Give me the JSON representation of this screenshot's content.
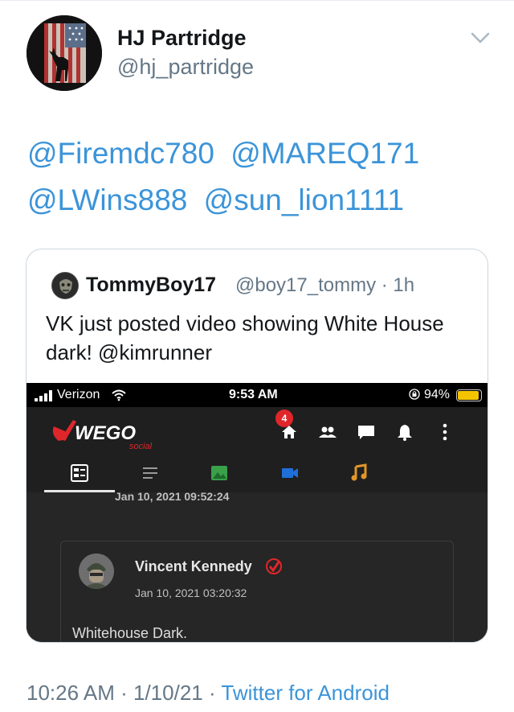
{
  "tweet": {
    "display_name": "HJ Partridge",
    "handle": "@hj_partridge",
    "mentions": [
      "@Firemdc780",
      "@MAREQ171",
      "@LWins888",
      "@sun_lion1111"
    ],
    "time": "10:26 AM",
    "separator": "·",
    "date": "1/10/21",
    "source": "Twitter for Android"
  },
  "quoted": {
    "display_name": "TommyBoy17",
    "handle_time": "@boy17_tommy · 1h",
    "text": "VK just posted video showing White House dark! @kimrunner"
  },
  "screenshot": {
    "status": {
      "carrier": "Verizon",
      "time": "9:53 AM",
      "battery": "94%",
      "battery_level": 0.94
    },
    "app": {
      "notification_count": "4"
    },
    "feed": {
      "prev_date": "Jan 10, 2021 09:52:24",
      "post": {
        "author": "Vincent Kennedy",
        "date": "Jan 10, 2021 03:20:32",
        "text": "Whitehouse Dark."
      }
    }
  },
  "icons": {
    "caret": "chevron-down-icon",
    "tabs": [
      "feed-icon",
      "list-icon",
      "photo-icon",
      "video-icon",
      "music-icon"
    ]
  },
  "colors": {
    "link": "#3b94d9",
    "muted": "#657786",
    "wego_red": "#e0262b"
  }
}
